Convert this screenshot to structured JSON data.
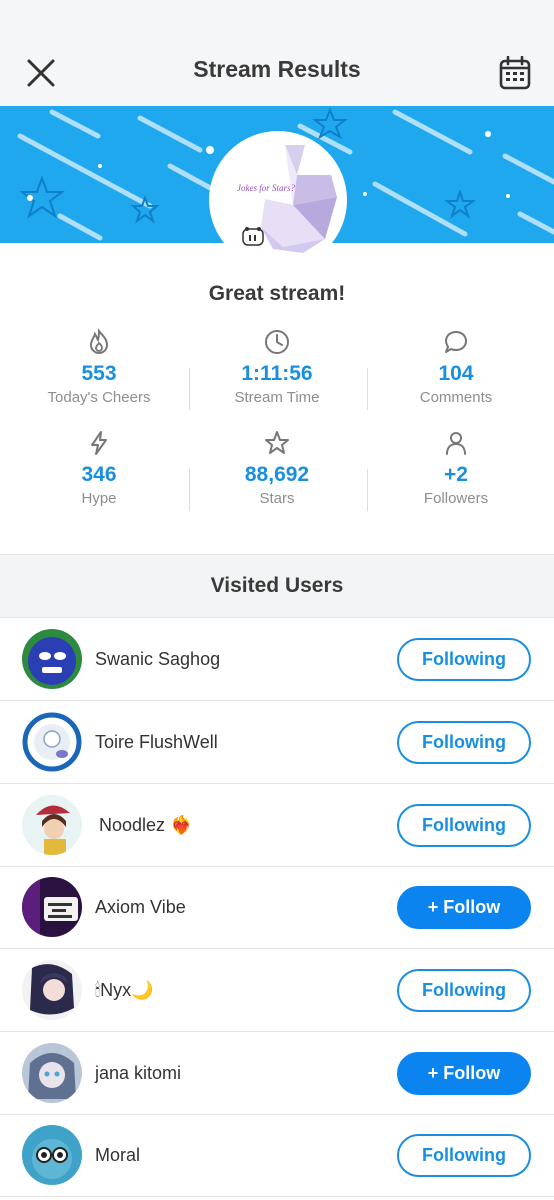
{
  "header": {
    "title": "Stream Results",
    "close_icon": "close-icon",
    "calendar_icon": "calendar-icon"
  },
  "stream": {
    "subtitle": "Great stream!",
    "avatar_text": "Jokes for Stars?",
    "stats": [
      {
        "icon": "flame-icon",
        "value": "553",
        "label": "Today's Cheers"
      },
      {
        "icon": "clock-icon",
        "value": "1:11:56",
        "label": "Stream Time"
      },
      {
        "icon": "comment-icon",
        "value": "104",
        "label": "Comments"
      },
      {
        "icon": "lightning-icon",
        "value": "346",
        "label": "Hype"
      },
      {
        "icon": "star-icon",
        "value": "88,692",
        "label": "Stars"
      },
      {
        "icon": "person-icon",
        "value": "+2",
        "label": "Followers"
      }
    ]
  },
  "visited": {
    "title": "Visited Users",
    "users": [
      {
        "name": "Swanic Saghog",
        "button": "Following",
        "following": true
      },
      {
        "name": "Toire FlushWell",
        "button": "Following",
        "following": true
      },
      {
        "name": "Noodlez ❤️‍🔥",
        "button": "Following",
        "following": true
      },
      {
        "name": "Axiom Vibe",
        "button": "+ Follow",
        "following": false
      },
      {
        "name": "🕯Nyx🌙",
        "button": "Following",
        "following": true
      },
      {
        "name": "jana kitomi",
        "button": "+ Follow",
        "following": false
      },
      {
        "name": "Moral",
        "button": "Following",
        "following": true
      }
    ]
  },
  "colors": {
    "accent": "#1a8fe0",
    "banner": "#1fa8ee",
    "follow_bg": "#0b84f0"
  }
}
